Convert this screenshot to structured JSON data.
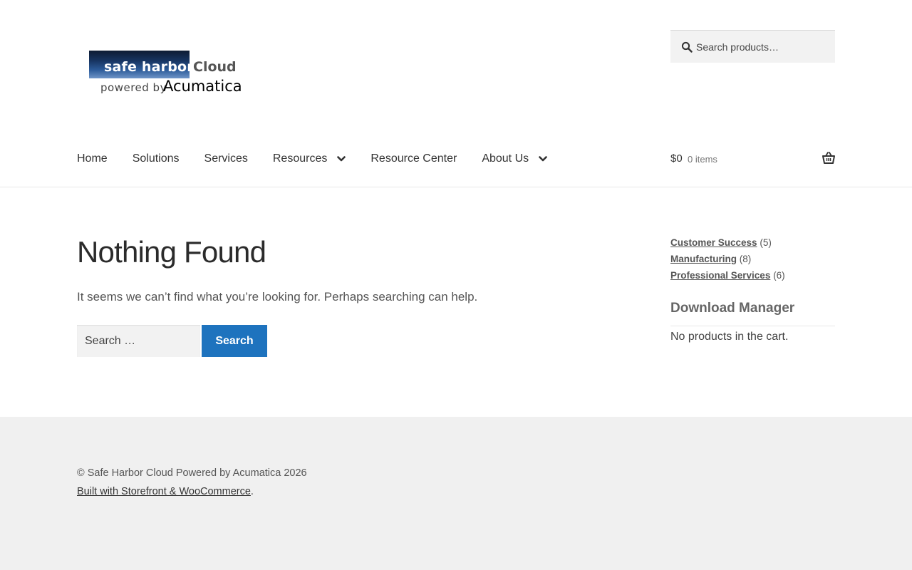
{
  "logo": {
    "word_main": "safe harbor",
    "word_cloud": "Cloud",
    "powered_by": "powered by",
    "brand": "Acumatica"
  },
  "header_search": {
    "placeholder": "Search products…",
    "icon": "search-icon"
  },
  "nav": {
    "items": [
      {
        "label": "Home"
      },
      {
        "label": "Solutions"
      },
      {
        "label": "Services"
      },
      {
        "label": "Resources"
      },
      {
        "label": "Resource Center"
      },
      {
        "label": "About Us"
      }
    ]
  },
  "cart": {
    "amount": "$0",
    "count": "0 items",
    "icon": "basket-icon"
  },
  "main": {
    "title": "Nothing Found",
    "message": "It seems we can’t find what you’re looking for. Perhaps searching can help.",
    "search_placeholder": "Search …",
    "search_button": "Search"
  },
  "sidebar": {
    "categories": [
      {
        "label": "Customer Success",
        "count": "(5)"
      },
      {
        "label": "Manufacturing",
        "count": "(8)"
      },
      {
        "label": "Professional Services",
        "count": "(6)"
      }
    ],
    "widget_title": "Download Manager",
    "widget_text": "No products in the cart."
  },
  "footer": {
    "copyright": "© Safe Harbor Cloud Powered by Acumatica 2026",
    "built_link": "Built with Storefront & WooCommerce",
    "built_suffix": "."
  },
  "colors": {
    "accent": "#1e73be",
    "footer_bg": "#f0f0f0",
    "input_bg": "#f2f2f2"
  }
}
